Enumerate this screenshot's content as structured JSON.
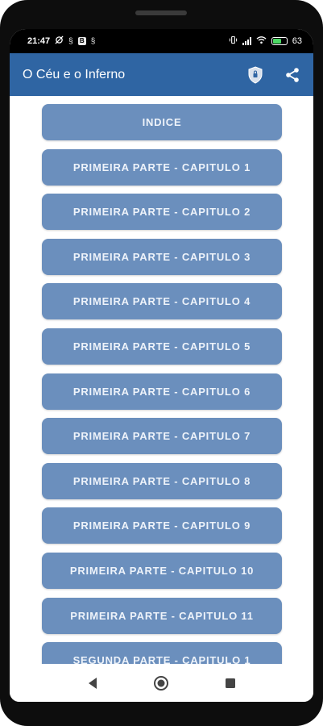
{
  "status_bar": {
    "time": "21:47",
    "left_glyphs": [
      "§",
      "§"
    ],
    "left_box": "B",
    "battery_percent": "63",
    "icons": [
      "phone-vibrate-icon",
      "signal-icon",
      "wifi-icon",
      "battery-icon"
    ]
  },
  "app_bar": {
    "title": "O Céu e o Inferno",
    "actions": [
      "shield-icon",
      "share-icon"
    ],
    "accent_color": "#2f65a3"
  },
  "chapter_list": {
    "button_color": "#6b8fbd",
    "items": [
      "INDICE",
      "PRIMEIRA PARTE - CAPITULO 1",
      "PRIMEIRA PARTE - CAPITULO 2",
      "PRIMEIRA PARTE - CAPITULO 3",
      "PRIMEIRA PARTE - CAPITULO 4",
      "PRIMEIRA PARTE - CAPITULO 5",
      "PRIMEIRA PARTE - CAPITULO 6",
      "PRIMEIRA PARTE - CAPITULO 7",
      "PRIMEIRA PARTE - CAPITULO 8",
      "PRIMEIRA PARTE - CAPITULO 9",
      "PRIMEIRA PARTE - CAPITULO 10",
      "PRIMEIRA PARTE - CAPITULO 11",
      "SEGUNDA PARTE - CAPITULO 1"
    ]
  },
  "nav_bar": {
    "buttons": [
      "back-icon",
      "home-icon",
      "recents-icon"
    ]
  }
}
